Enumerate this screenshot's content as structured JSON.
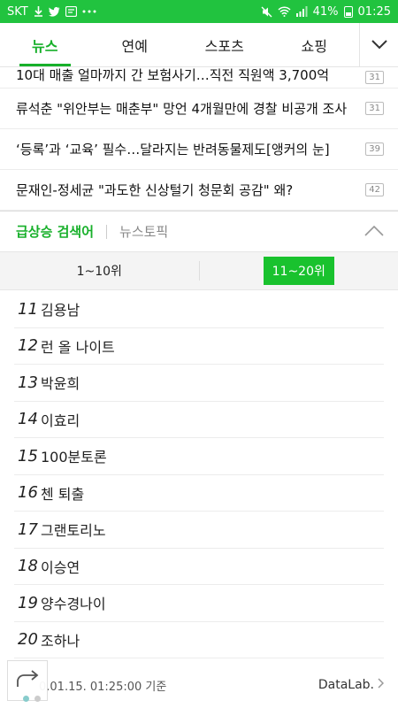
{
  "status_bar": {
    "carrier": "SKT",
    "battery_percent": "41%",
    "time": "01:25"
  },
  "nav": {
    "tabs": [
      {
        "label": "뉴스",
        "active": true
      },
      {
        "label": "연예",
        "active": false
      },
      {
        "label": "스포츠",
        "active": false
      },
      {
        "label": "쇼핑",
        "active": false
      }
    ]
  },
  "headlines": [
    {
      "text": "10대 매출 얼마까지 간 보험사기…직전 직원액 3,700억",
      "comments": "31"
    },
    {
      "text": "류석춘 \"위안부는 매춘부\" 망언 4개월만에 경찰 비공개 조사",
      "comments": "31"
    },
    {
      "text": "‘등록’과 ‘교육’ 필수…달라지는 반려동물제도[앵커의 눈]",
      "comments": "39"
    },
    {
      "text": "문재인-정세균 \"과도한 신상털기 청문회 공감\" 왜?",
      "comments": "42"
    }
  ],
  "rising": {
    "title": "급상승 검색어",
    "subtitle": "뉴스토픽",
    "range_tabs": [
      {
        "label": "1~10위",
        "active": false
      },
      {
        "label": "11~20위",
        "active": true
      }
    ],
    "items": [
      {
        "rank": "11",
        "keyword": "김용남"
      },
      {
        "rank": "12",
        "keyword": "런 올 나이트"
      },
      {
        "rank": "13",
        "keyword": "박윤희"
      },
      {
        "rank": "14",
        "keyword": "이효리"
      },
      {
        "rank": "15",
        "keyword": "100분토론"
      },
      {
        "rank": "16",
        "keyword": "첸 퇴출"
      },
      {
        "rank": "17",
        "keyword": "그랜토리노"
      },
      {
        "rank": "18",
        "keyword": "이승연"
      },
      {
        "rank": "19",
        "keyword": "양수경나이"
      },
      {
        "rank": "20",
        "keyword": "조하나"
      }
    ]
  },
  "footer": {
    "timestamp": "0.01.15. 01:25:00 기준",
    "datalab": "DataLab."
  }
}
